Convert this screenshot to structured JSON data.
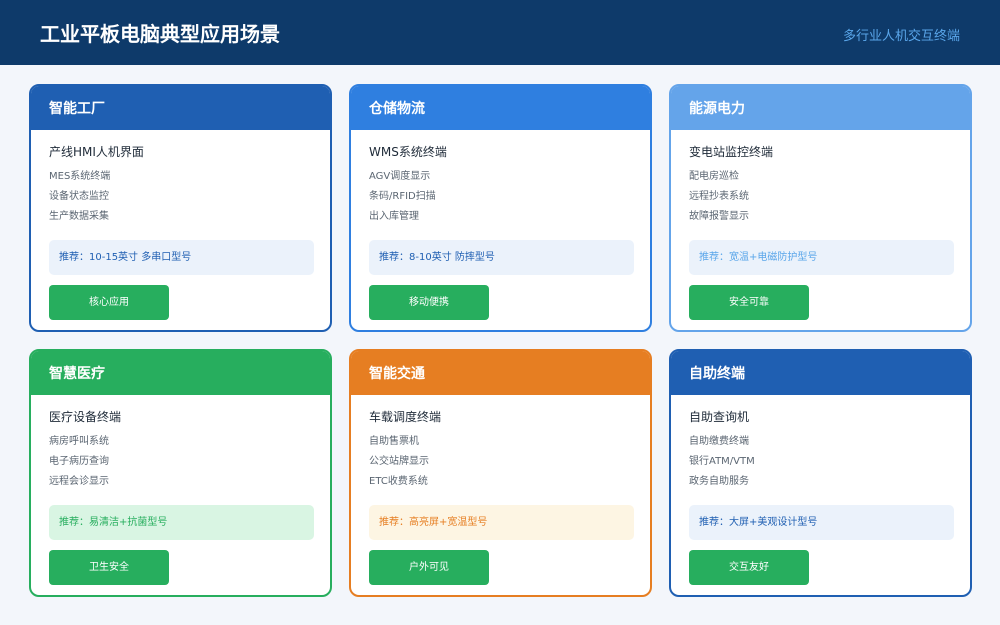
{
  "header": {
    "title": "工业平板电脑典型应用场景",
    "subtitle": "多行业人机交互终端"
  },
  "colors": {
    "header_bg": "#0e3a6a",
    "dark_blue": "#1f5fb2",
    "blue": "#2f7fe0",
    "light_blue": "#64a4ea",
    "green": "#27ae5e",
    "orange": "#e67e22"
  },
  "cards": [
    {
      "title": "智能工厂",
      "subtitle": "产线HMI人机界面",
      "features": [
        "MES系统终端",
        "设备状态监控",
        "生产数据采集"
      ],
      "recommendation": "推荐：10-15英寸 多串口型号",
      "button": "核心应用",
      "theme": "dark-blue"
    },
    {
      "title": "仓储物流",
      "subtitle": "WMS系统终端",
      "features": [
        "AGV调度显示",
        "条码/RFID扫描",
        "出入库管理"
      ],
      "recommendation": "推荐：8-10英寸 防摔型号",
      "button": "移动便携",
      "theme": "blue"
    },
    {
      "title": "能源电力",
      "subtitle": "变电站监控终端",
      "features": [
        "配电房巡检",
        "远程抄表系统",
        "故障报警显示"
      ],
      "recommendation": "推荐：宽温+电磁防护型号",
      "button": "安全可靠",
      "theme": "light-blue"
    },
    {
      "title": "智慧医疗",
      "subtitle": "医疗设备终端",
      "features": [
        "病房呼叫系统",
        "电子病历查询",
        "远程会诊显示"
      ],
      "recommendation": "推荐：易清洁+抗菌型号",
      "button": "卫生安全",
      "theme": "green"
    },
    {
      "title": "智能交通",
      "subtitle": "车载调度终端",
      "features": [
        "自助售票机",
        "公交站牌显示",
        "ETC收费系统"
      ],
      "recommendation": "推荐：高亮屏+宽温型号",
      "button": "户外可见",
      "theme": "orange"
    },
    {
      "title": "自助终端",
      "subtitle": "自助查询机",
      "features": [
        "自助缴费终端",
        "银行ATM/VTM",
        "政务自助服务"
      ],
      "recommendation": "推荐：大屏+美观设计型号",
      "button": "交互友好",
      "theme": "dark-blue"
    }
  ]
}
